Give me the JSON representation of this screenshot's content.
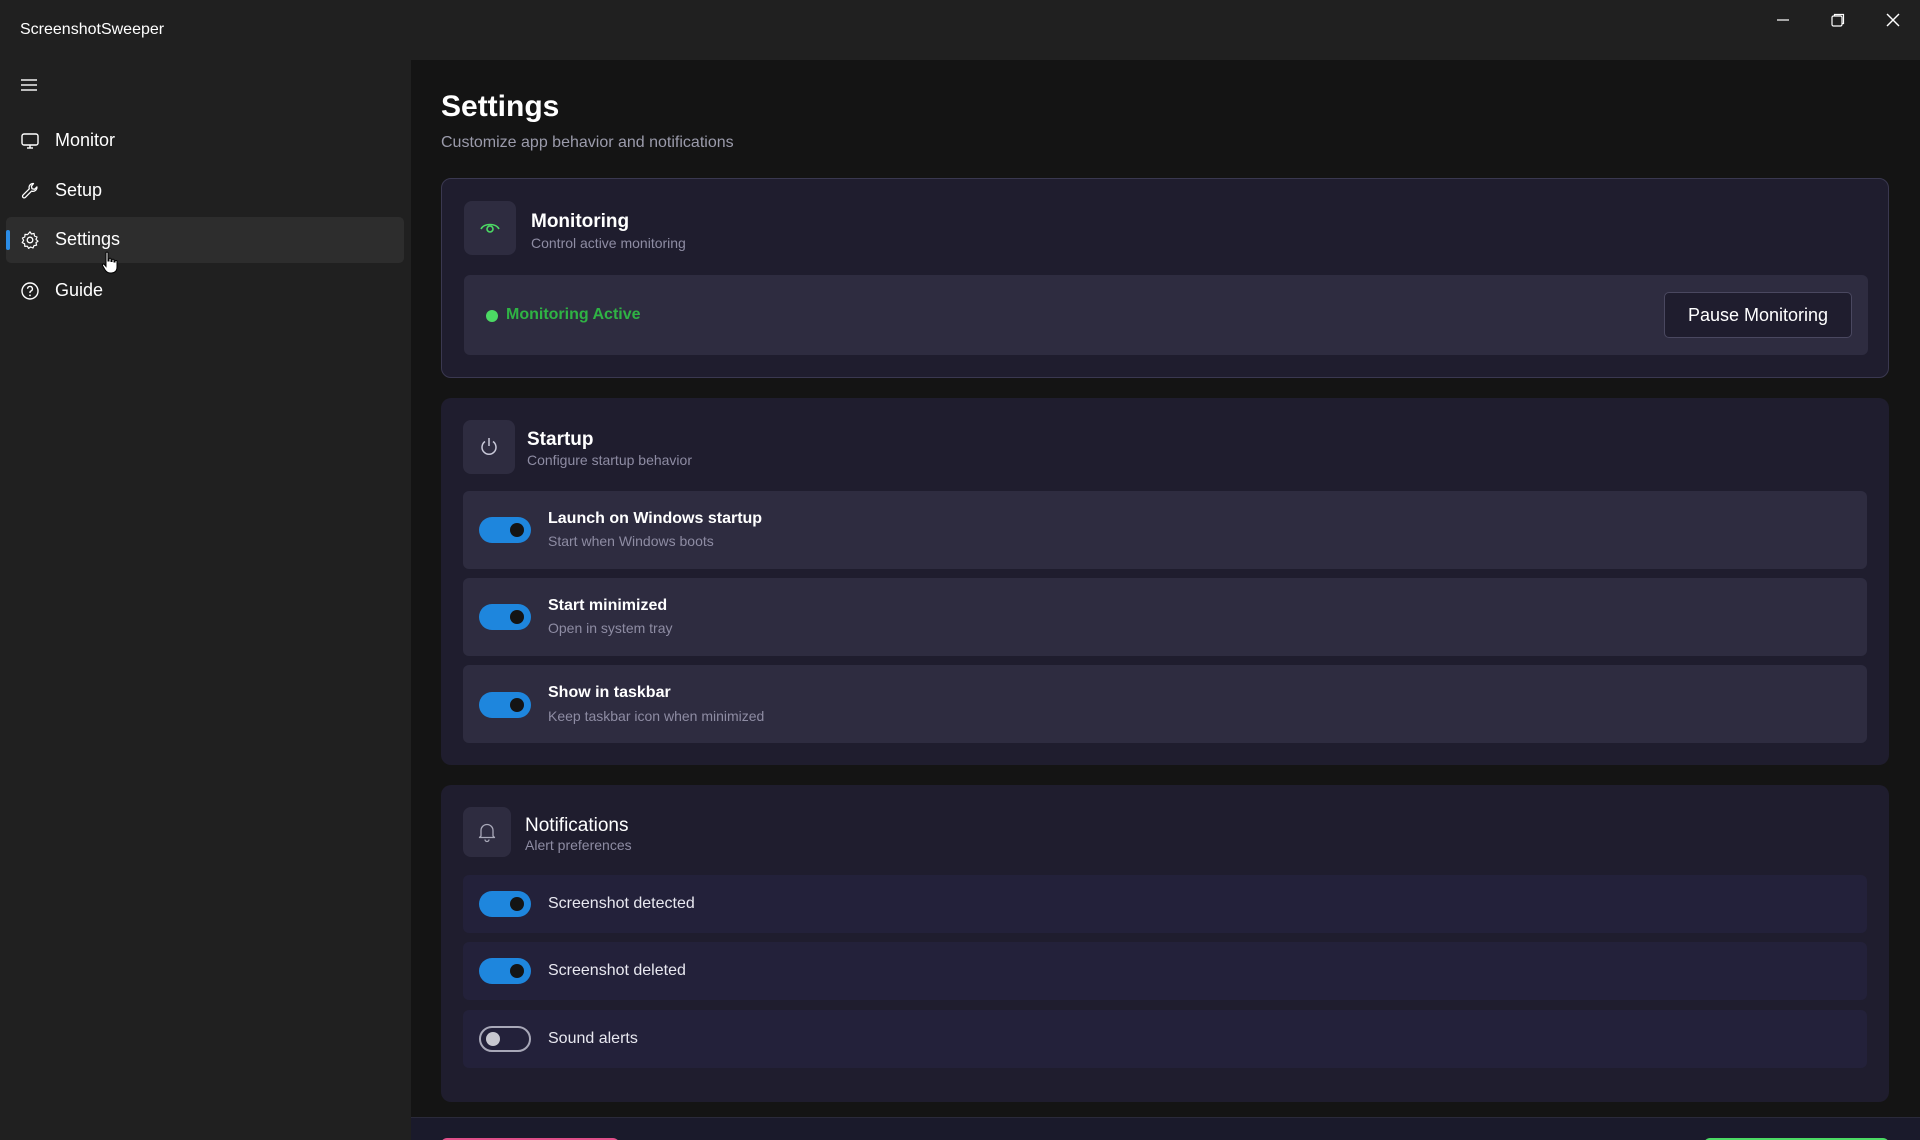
{
  "app": {
    "title": "ScreenshotSweeper"
  },
  "window_controls": {
    "minimize": "minimize-icon",
    "restore": "restore-icon",
    "close": "close-icon"
  },
  "sidebar": {
    "menu_icon": "hamburger-icon",
    "items": [
      {
        "label": "Monitor",
        "icon": "monitor-icon",
        "active": false
      },
      {
        "label": "Setup",
        "icon": "wrench-icon",
        "active": false
      },
      {
        "label": "Settings",
        "icon": "gear-icon",
        "active": true
      },
      {
        "label": "Guide",
        "icon": "help-circle-icon",
        "active": false
      }
    ]
  },
  "page": {
    "title": "Settings",
    "subtitle": "Customize app behavior and notifications"
  },
  "monitoring": {
    "title": "Monitoring",
    "subtitle": "Control active monitoring",
    "icon": "eye-icon",
    "status": "Monitoring Active",
    "status_color": "#4cd964",
    "button_label": "Pause Monitoring"
  },
  "startup": {
    "title": "Startup",
    "subtitle": "Configure startup behavior",
    "icon": "power-icon",
    "options": [
      {
        "title": "Launch on Windows startup",
        "subtitle": "Start when Windows boots",
        "enabled": true
      },
      {
        "title": "Start minimized",
        "subtitle": "Open in system tray",
        "enabled": true
      },
      {
        "title": "Show in taskbar",
        "subtitle": "Keep taskbar icon when minimized",
        "enabled": true
      }
    ]
  },
  "notifications": {
    "title": "Notifications",
    "subtitle": "Alert preferences",
    "icon": "bell-icon",
    "options": [
      {
        "label": "Screenshot detected",
        "enabled": true
      },
      {
        "label": "Screenshot deleted",
        "enabled": true
      },
      {
        "label": "Sound alerts",
        "enabled": false
      }
    ]
  },
  "colors": {
    "accent": "#1e86dd",
    "background": "#141414",
    "sidebar": "#202020",
    "card": "#1f1d2e",
    "row": "#2e2c40"
  }
}
